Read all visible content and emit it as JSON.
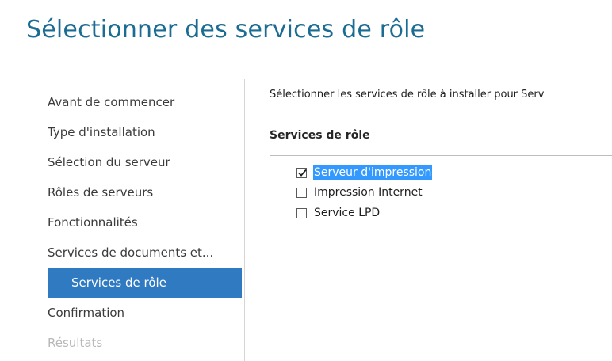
{
  "title": "Sélectionner des services de rôle",
  "nav": {
    "items": [
      {
        "label": "Avant de commencer",
        "state": "normal"
      },
      {
        "label": "Type d'installation",
        "state": "normal"
      },
      {
        "label": "Sélection du serveur",
        "state": "normal"
      },
      {
        "label": "Rôles de serveurs",
        "state": "normal"
      },
      {
        "label": "Fonctionnalités",
        "state": "normal"
      },
      {
        "label": "Services de documents et...",
        "state": "normal"
      },
      {
        "label": "Services de rôle",
        "state": "selected"
      },
      {
        "label": "Confirmation",
        "state": "normal"
      },
      {
        "label": "Résultats",
        "state": "disabled"
      }
    ]
  },
  "content": {
    "description": "Sélectionner les services de rôle à installer pour Serv",
    "section_label": "Services de rôle",
    "role_services": [
      {
        "label": "Serveur d'impression",
        "checked": true,
        "highlighted": true
      },
      {
        "label": "Impression Internet",
        "checked": false,
        "highlighted": false
      },
      {
        "label": "Service LPD",
        "checked": false,
        "highlighted": false
      }
    ]
  },
  "colors": {
    "title": "#1b6c93",
    "nav_selected_bg": "#2f7ac1",
    "selection_highlight": "#3399ff",
    "disabled_text": "#b8b8b8"
  }
}
